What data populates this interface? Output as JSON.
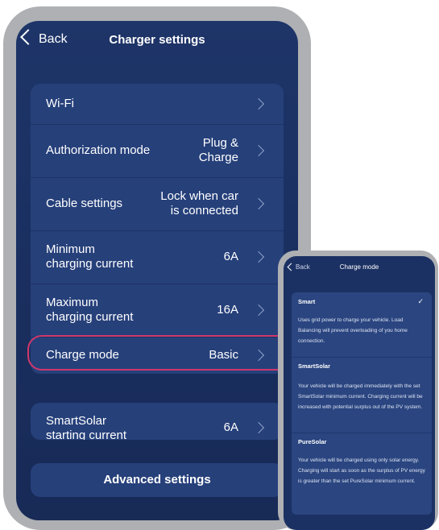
{
  "main": {
    "back_label": "Back",
    "title": "Charger settings",
    "rows": [
      {
        "label": "Wi-Fi",
        "value": ""
      },
      {
        "label": "Authorization mode",
        "value": "Plug &\nCharge"
      },
      {
        "label": "Cable settings",
        "value": "Lock when car\nis connected"
      },
      {
        "label": "Minimum\ncharging current",
        "value": "6A"
      },
      {
        "label": "Maximum\ncharging current",
        "value": "16A"
      },
      {
        "label": "Charge mode",
        "value": "Basic"
      }
    ],
    "solar_row": {
      "label": "SmartSolar\nstarting current",
      "value": "6A"
    },
    "advanced_label": "Advanced settings",
    "highlight_color": "#d0386b"
  },
  "detail": {
    "back_label": "Back",
    "title": "Charge mode",
    "options": [
      {
        "name": "Smart",
        "selected": true,
        "description": "Uses grid power to charge your vehicle. Load Balancing will prevent overloading of you home connection."
      },
      {
        "name": "SmartSolar",
        "selected": false,
        "description": "Your vehicle will be charged immediately with the set SmartSolar minimum current. Charging current will be increased with potential surplus out of the PV system."
      },
      {
        "name": "PureSolar",
        "selected": false,
        "description": "Your vehicle will be charged using only solar energy. Charging will start as soon as the surplus of PV energy is greater than the set PureSolar minimum current."
      }
    ],
    "check_glyph": "✓"
  },
  "icons": {
    "back": "chevron-left-icon",
    "row": "chevron-right-icon",
    "selected": "checkmark-icon"
  }
}
